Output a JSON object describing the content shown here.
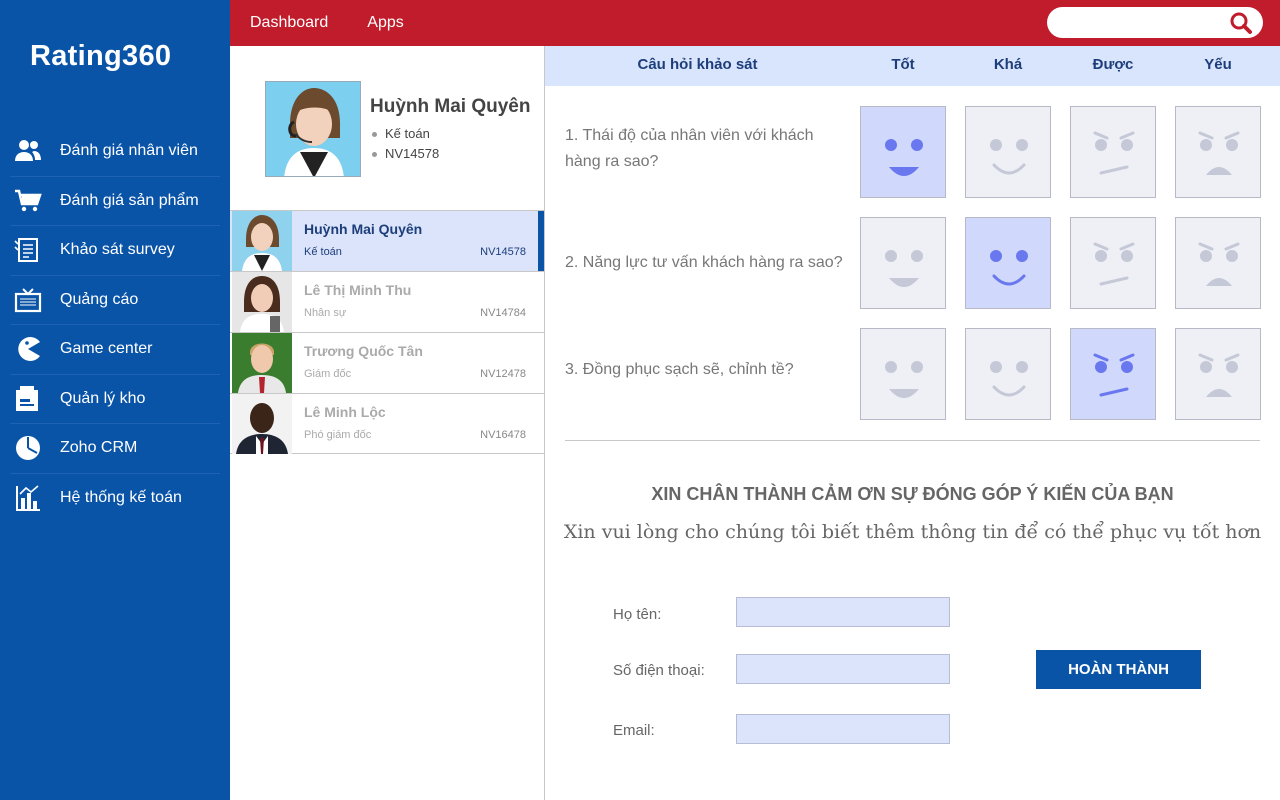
{
  "app": {
    "title": "Rating360"
  },
  "sidebar": {
    "items": [
      {
        "label": "Đánh giá nhân viên",
        "icon": "users-icon"
      },
      {
        "label": "Đánh giá sản phẩm",
        "icon": "cart-icon"
      },
      {
        "label": "Khảo sát survey",
        "icon": "survey-icon"
      },
      {
        "label": "Quảng cáo",
        "icon": "tv-icon"
      },
      {
        "label": "Game center",
        "icon": "pacman-icon"
      },
      {
        "label": "Quản lý kho",
        "icon": "warehouse-icon"
      },
      {
        "label": "Zoho CRM",
        "icon": "pie-chart-icon"
      },
      {
        "label": "Hệ thống kế toán",
        "icon": "bar-chart-icon"
      }
    ]
  },
  "topbar": {
    "nav": [
      {
        "label": "Dashboard"
      },
      {
        "label": "Apps"
      }
    ],
    "search": {
      "placeholder": "",
      "value": "",
      "icon": "search-icon"
    },
    "color": "#c01c2b"
  },
  "profile": {
    "name": "Huỳnh Mai Quyên",
    "role": "Kế toán",
    "code": "NV14578"
  },
  "employees": [
    {
      "name": "Huỳnh Mai Quyên",
      "role": "Kế toán",
      "code": "NV14578",
      "active": true
    },
    {
      "name": "Lê Thị Minh Thu",
      "role": "Nhân sự",
      "code": "NV14784",
      "active": false
    },
    {
      "name": "Trương Quốc Tân",
      "role": "Giám đốc",
      "code": "NV12478",
      "active": false
    },
    {
      "name": "Lê Minh Lộc",
      "role": "Phó giám đốc",
      "code": "NV16478",
      "active": false
    }
  ],
  "survey": {
    "header": {
      "question": "Câu hỏi khảo sát",
      "r1": "Tốt",
      "r2": "Khá",
      "r3": "Được",
      "r4": "Yếu"
    },
    "questions": [
      {
        "text": "1. Thái độ của nhân viên với khách hàng ra sao?",
        "selected": "Tốt"
      },
      {
        "text": "2. Năng lực tư vấn khách hàng ra sao?",
        "selected": "Khá"
      },
      {
        "text": "3. Đồng phục sạch sẽ, chỉnh tề?",
        "selected": "Được"
      }
    ]
  },
  "feedback": {
    "title": "XIN CHÂN THÀNH CẢM ƠN SỰ ĐÓNG GÓP Ý KIẾN CỦA BẠN",
    "subtitle": "Xin vui lòng cho chúng tôi biết thêm thông tin để có thể phục vụ tốt hơn",
    "name_label": "Họ tên:",
    "phone_label": "Số điện thoại:",
    "email_label": "Email:",
    "name_value": "",
    "phone_value": "",
    "email_value": "",
    "submit_label": "HOÀN THÀNH"
  },
  "colors": {
    "brand": "#0a54a8",
    "accent": "#c01c2b",
    "selected": "#d0d8fb"
  }
}
